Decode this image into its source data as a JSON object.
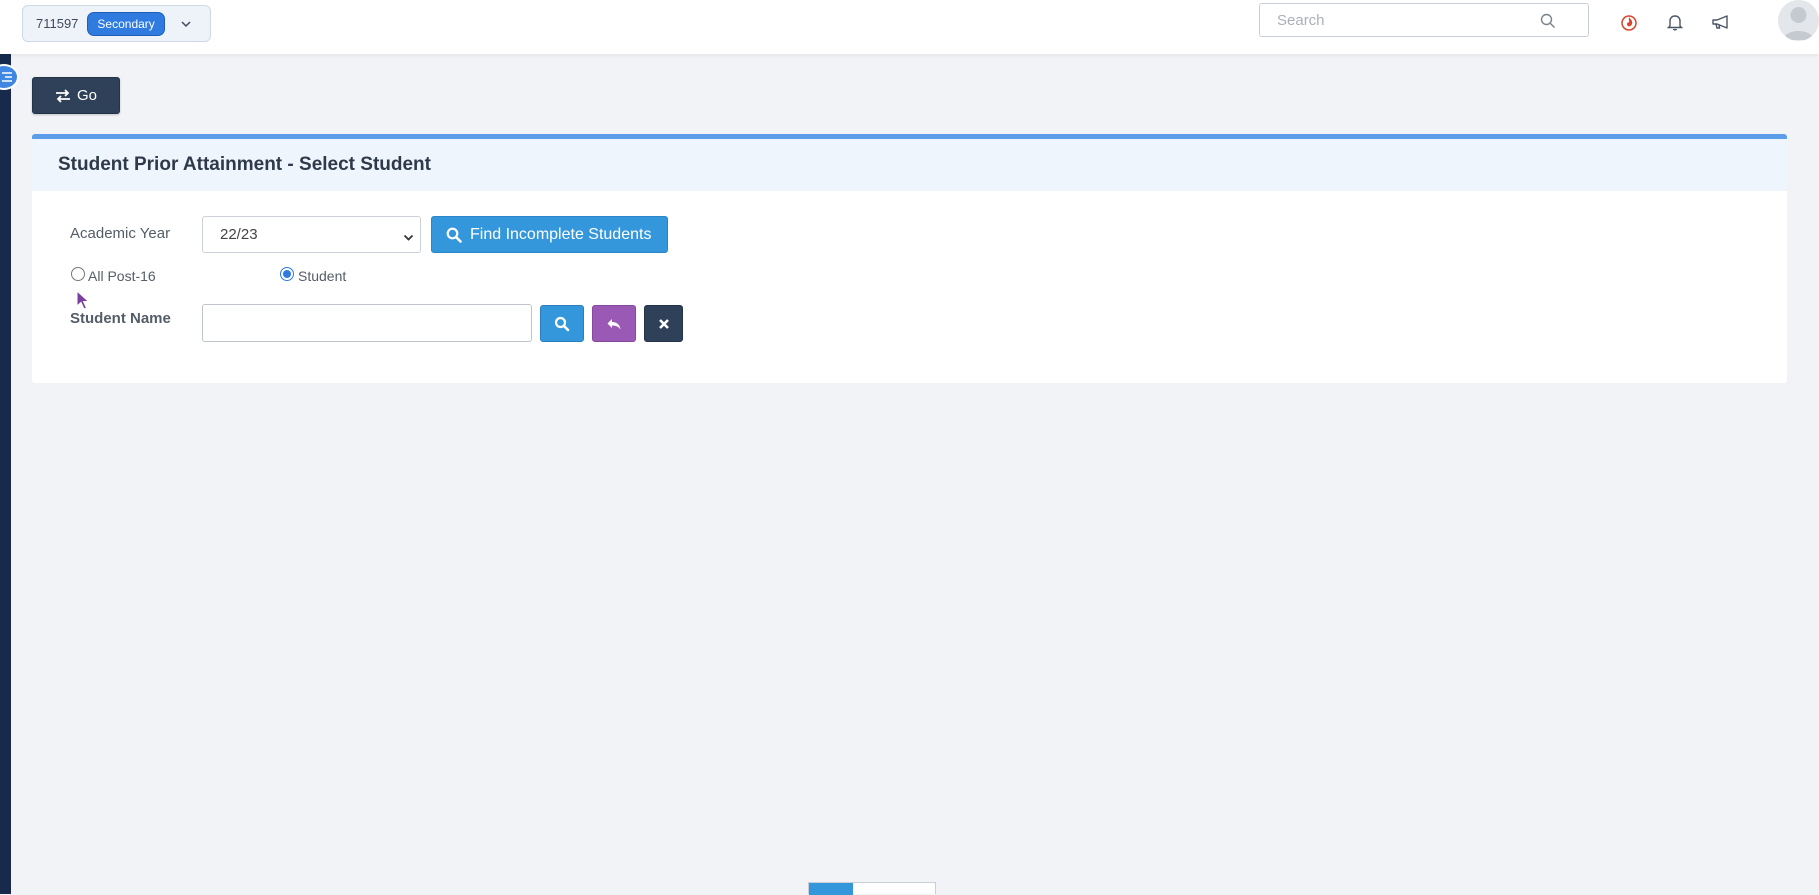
{
  "topbar": {
    "school_id": "711597",
    "school_phase": "Secondary",
    "search_placeholder": "Search",
    "icons": [
      "fire-icon",
      "bell-icon",
      "megaphone-icon"
    ]
  },
  "toolbar": {
    "go_label": "Go"
  },
  "panel": {
    "title": "Student Prior Attainment - Select Student",
    "academic_year_label": "Academic Year",
    "academic_year_value": "22/23",
    "find_button_label": "Find Incomplete Students",
    "radio_all_label": "All Post-16",
    "radio_student_label": "Student",
    "radio_selected": "Student",
    "student_name_label": "Student Name",
    "student_name_value": ""
  },
  "colors": {
    "primary_blue": "#3497dc",
    "badge_blue": "#2f7be0",
    "dark_navy": "#2e4159",
    "purple": "#9b59b6",
    "fire_red": "#d9442a"
  }
}
